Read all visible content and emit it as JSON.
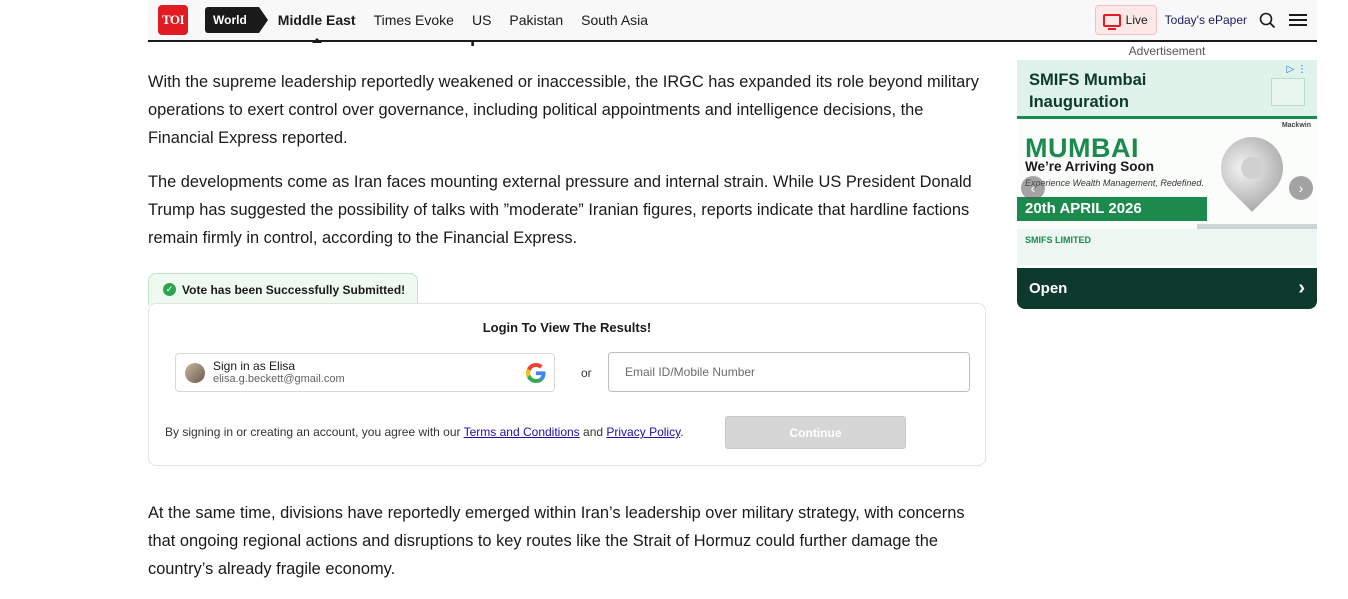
{
  "header": {
    "logo_text": "TOI",
    "section_label": "World",
    "nav_items": [
      "Middle East",
      "Times Evoke",
      "US",
      "Pakistan",
      "South Asia"
    ],
    "live_label": "Live",
    "epaper_label": "Today's ePaper",
    "icons": {
      "search": "search-icon",
      "menu": "hamburger-menu-icon",
      "live": "tv-icon"
    }
  },
  "article": {
    "cut_heading": "IRGC asserts control amid external pressure",
    "paragraphs": [
      "With the supreme leadership reportedly weakened or inaccessible, the IRGC has expanded its role beyond military operations to exert control over governance, including political appointments and intelligence decisions, the Financial Express reported.",
      "The developments come as Iran faces mounting external pressure and internal strain. While US President Donald Trump has suggested the possibility of talks with ”moderate” Iranian figures, reports indicate that hardline factions remain firmly in control, according to the Financial Express.",
      "At the same time, divisions have reportedly emerged within Iran’s leadership over military strategy, with concerns that ongoing regional actions and disruptions to key routes like the Strait of Hormuz could further damage the country’s already fragile economy."
    ]
  },
  "poll": {
    "vote_status": "Vote has been Successfully Submitted!",
    "login_title": "Login To View The Results!",
    "google_name": "Sign in as Elisa",
    "google_email": "elisa.g.beckett@gmail.com",
    "or_label": "or",
    "email_placeholder": "Email ID/Mobile Number",
    "terms_prefix": "By signing in or creating an account, you agree with our ",
    "terms_link": "Terms and Conditions",
    "terms_and": " and ",
    "privacy_link": "Privacy Policy",
    "terms_suffix": ".",
    "continue_label": "Continue",
    "colors": {
      "success": "#2ea44f",
      "link": "#1a0dab"
    }
  },
  "ad": {
    "label": "Advertisement",
    "top_title": "SMIFS Mumbai Inauguration",
    "city": "MUMBAI",
    "arriving": "We’re Arriving Soon",
    "tagline": "Experience Wealth Management, Redefined.",
    "date": "20th APRIL 2026",
    "company": "SMIFS LIMITED",
    "brand_mark": "Mackwin",
    "cta": "Open",
    "colors": {
      "brand_green": "#1b8a4c",
      "dark_green": "#0d3a2d"
    }
  }
}
